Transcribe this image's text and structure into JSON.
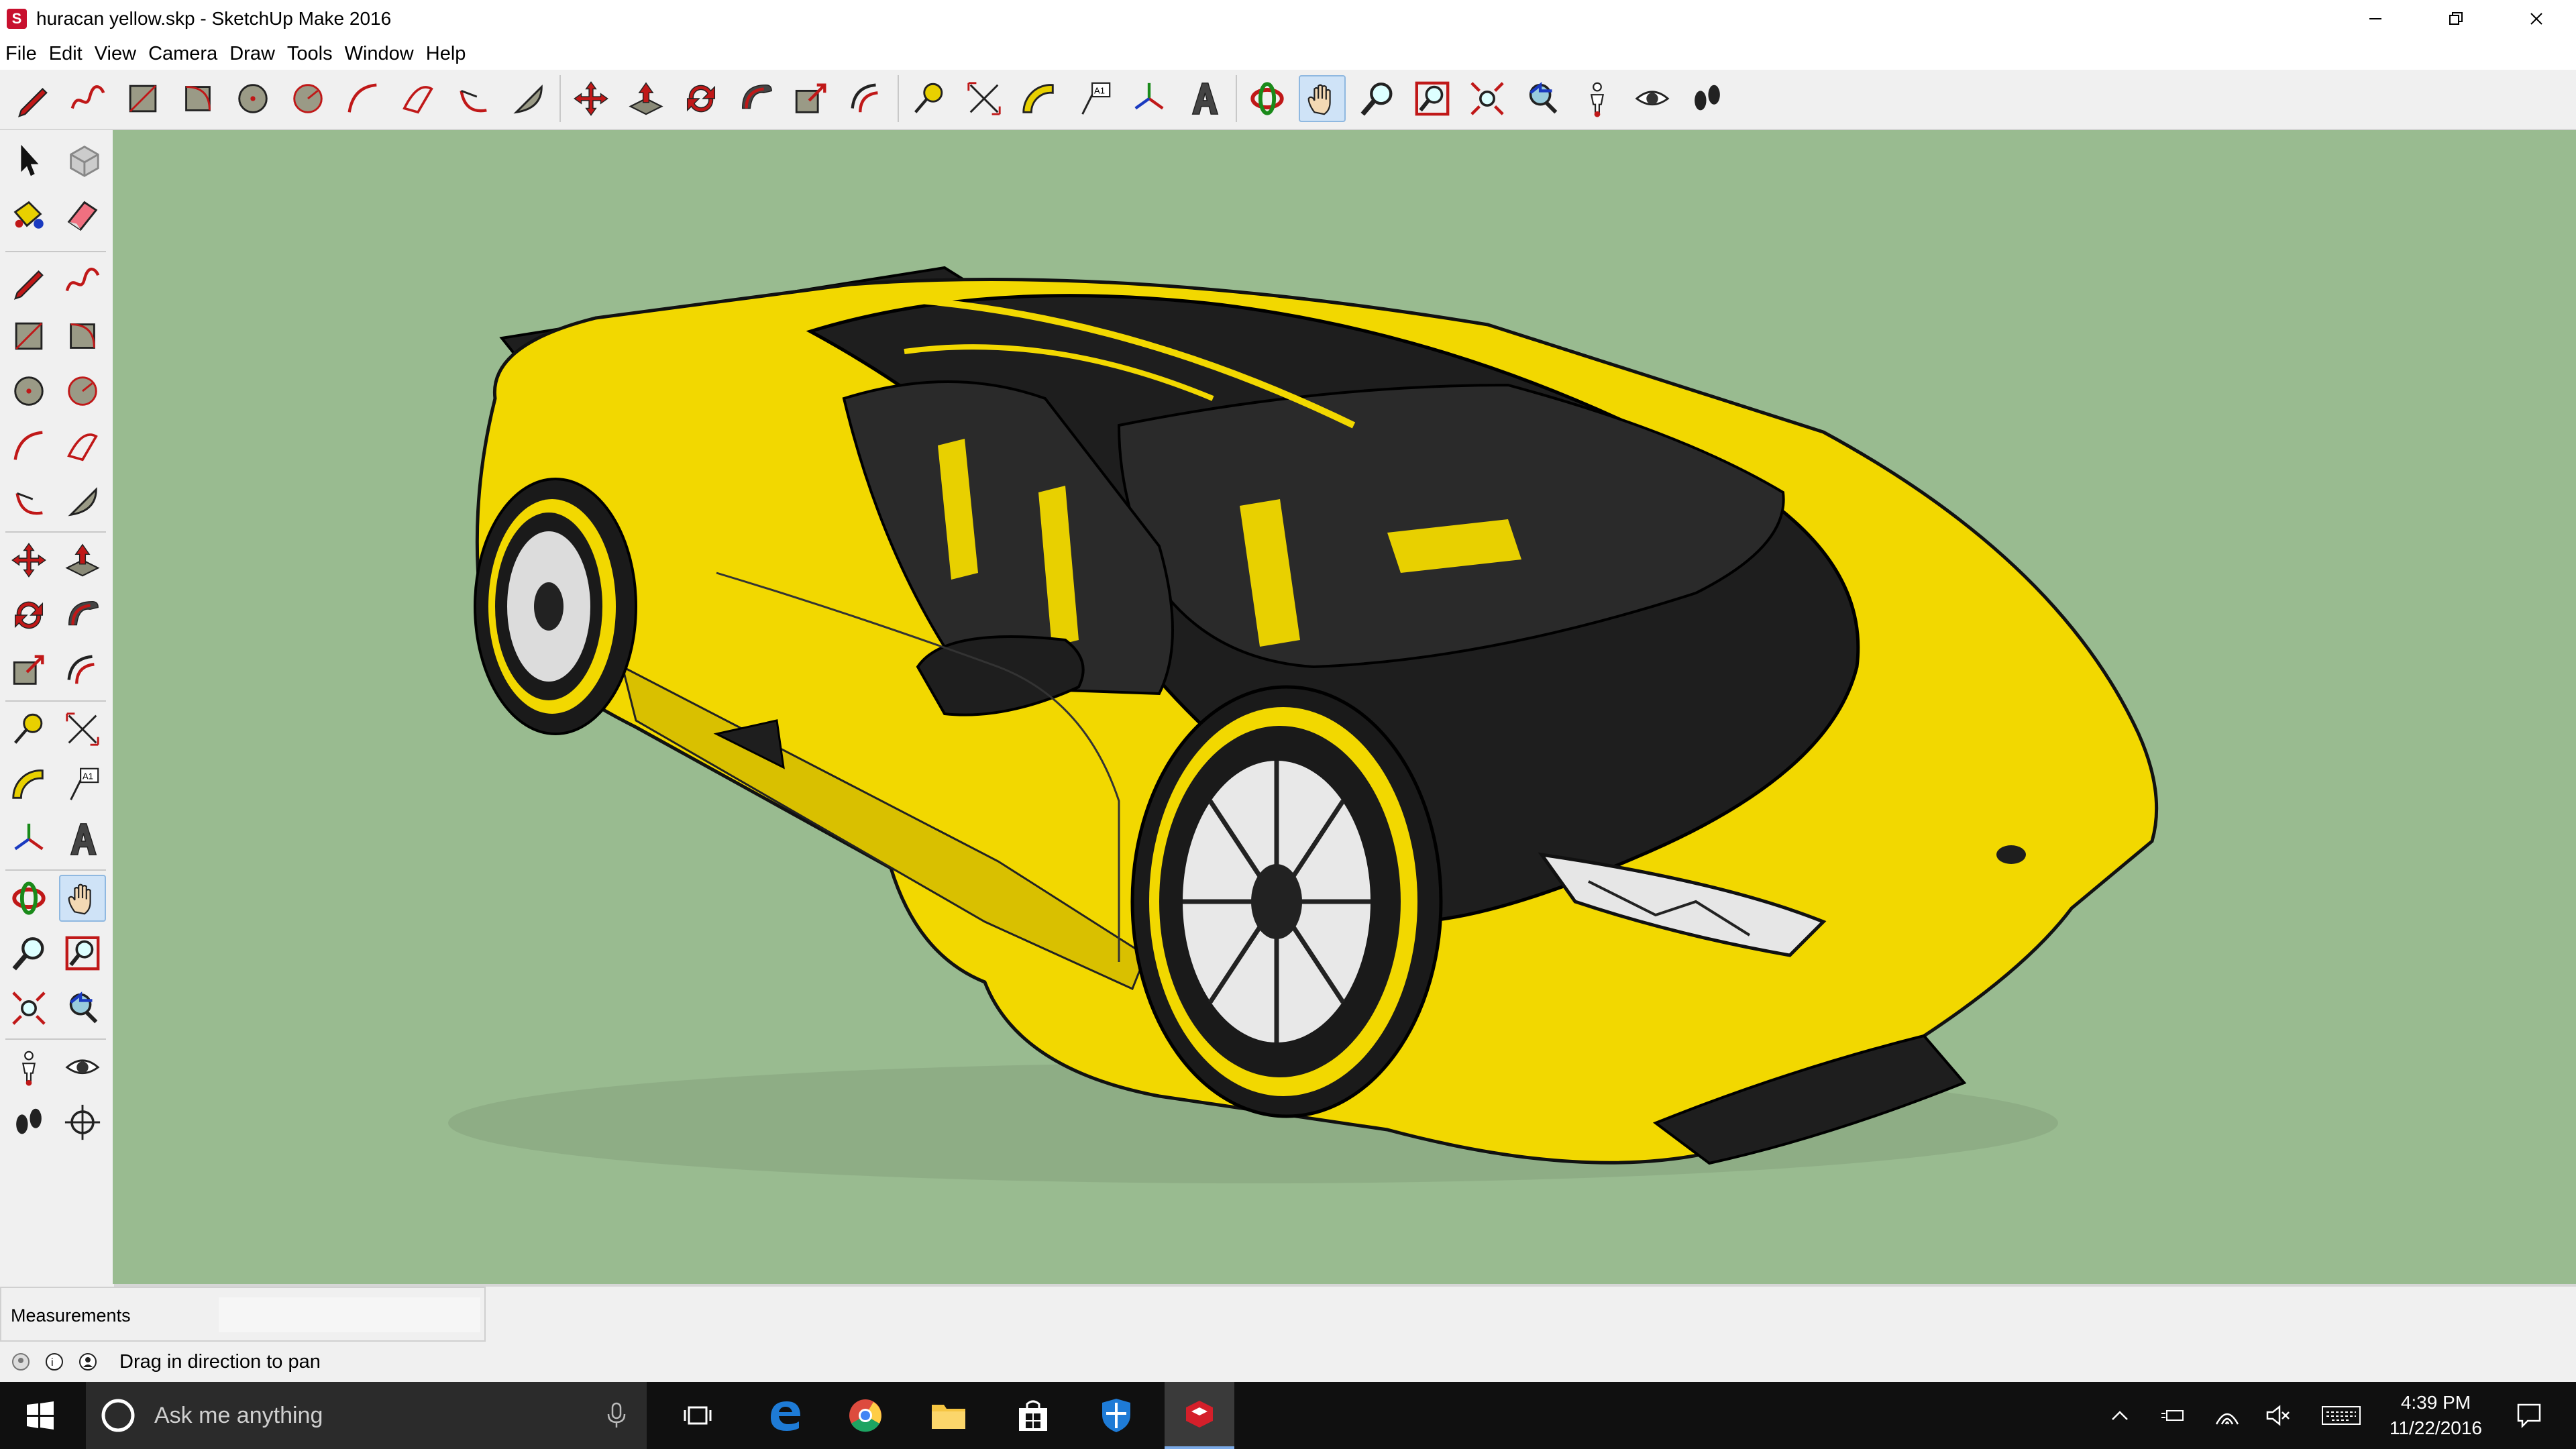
{
  "window": {
    "title": "huracan yellow.skp - SketchUp Make 2016",
    "app_icon": "sketchup-icon"
  },
  "menu": [
    {
      "label": "File"
    },
    {
      "label": "Edit"
    },
    {
      "label": "View"
    },
    {
      "label": "Camera"
    },
    {
      "label": "Draw"
    },
    {
      "label": "Tools"
    },
    {
      "label": "Window"
    },
    {
      "label": "Help"
    }
  ],
  "toolbar": {
    "active_tool": "pan",
    "tools": [
      "line",
      "freehand",
      "rectangle",
      "rotated-rectangle",
      "circle",
      "polygon",
      "arc",
      "2-point-arc",
      "3-point-arc",
      "pie",
      "move",
      "push-pull",
      "rotate",
      "follow-me",
      "scale",
      "offset",
      "tape-measure",
      "dimensions",
      "protractor",
      "text",
      "axes",
      "3d-text",
      "orbit",
      "pan",
      "zoom",
      "zoom-window",
      "zoom-extents",
      "previous-view",
      "position-camera",
      "look-around",
      "walk"
    ]
  },
  "colors": {
    "viewport_bg": "#99bb90",
    "car_body": "#f2d800",
    "car_black": "#1e1e1e",
    "taskbar": "#101010"
  },
  "measurements": {
    "label": "Measurements",
    "value": ""
  },
  "status": {
    "text": "Drag in direction to pan"
  },
  "taskbar": {
    "search_placeholder": "Ask me anything",
    "apps": [
      "task-view",
      "edge",
      "chrome",
      "file-explorer",
      "store",
      "defender",
      "sketchup"
    ],
    "time": "4:39 PM",
    "date": "11/22/2016"
  }
}
